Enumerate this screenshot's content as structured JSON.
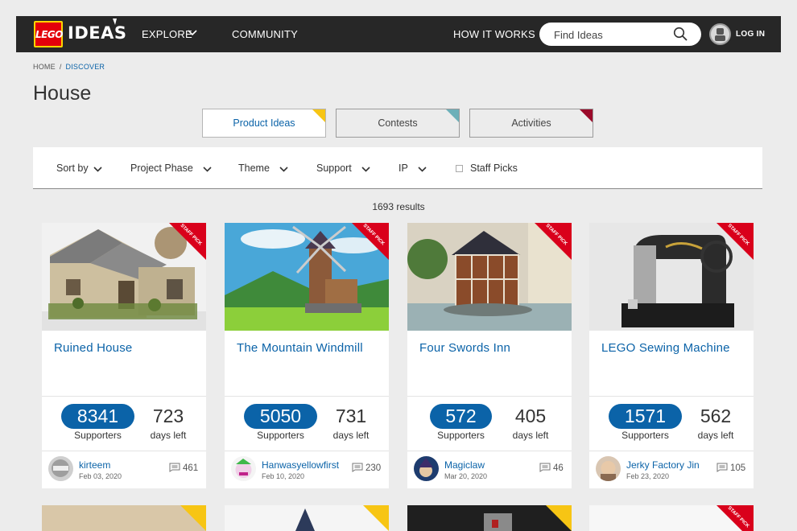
{
  "header": {
    "logo_brand": "LEGO",
    "logo_text": "IDEAS",
    "nav": {
      "explore": "EXPLORE",
      "community": "COMMUNITY",
      "how_it_works": "HOW IT WORKS"
    },
    "search_placeholder": "Find Ideas",
    "login": "LOG IN"
  },
  "breadcrumb": {
    "home": "HOME",
    "separator": "/",
    "current": "DISCOVER"
  },
  "page_title": "House",
  "tabs": [
    {
      "label": "Product Ideas",
      "active": true,
      "corner_color": "#f7c514"
    },
    {
      "label": "Contests",
      "active": false,
      "corner_color": "#6db0b9"
    },
    {
      "label": "Activities",
      "active": false,
      "corner_color": "#9b0a2a"
    }
  ],
  "filters": {
    "sort_by": "Sort by",
    "project_phase": "Project Phase",
    "theme": "Theme",
    "support": "Support",
    "ip": "IP",
    "staff_picks": "Staff Picks"
  },
  "results_text": "1693 results",
  "staff_pick_label": "STAFF PICK",
  "cards": [
    {
      "title": "Ruined House",
      "supporters": "8341",
      "supporters_label": "Supporters",
      "days": "723",
      "days_label": "days left",
      "author": "kirteem",
      "date": "Feb 03, 2020",
      "comments": "461"
    },
    {
      "title": "The Mountain Windmill",
      "supporters": "5050",
      "supporters_label": "Supporters",
      "days": "731",
      "days_label": "days left",
      "author": "Hanwasyellowfirst",
      "date": "Feb 10, 2020",
      "comments": "230"
    },
    {
      "title": "Four Swords Inn",
      "supporters": "572",
      "supporters_label": "Supporters",
      "days": "405",
      "days_label": "days left",
      "author": "Magiclaw",
      "date": "Mar 20, 2020",
      "comments": "46"
    },
    {
      "title": "LEGO Sewing Machine",
      "supporters": "1571",
      "supporters_label": "Supporters",
      "days": "562",
      "days_label": "days left",
      "author": "Jerky Factory Jin",
      "date": "Feb 23, 2020",
      "comments": "105"
    }
  ],
  "colors": {
    "nav_bg": "#272727",
    "accent_blue": "#0b63a8",
    "lego_red": "#e3000b",
    "staff_red": "#d9001b",
    "badge_yellow": "#f7c514"
  }
}
